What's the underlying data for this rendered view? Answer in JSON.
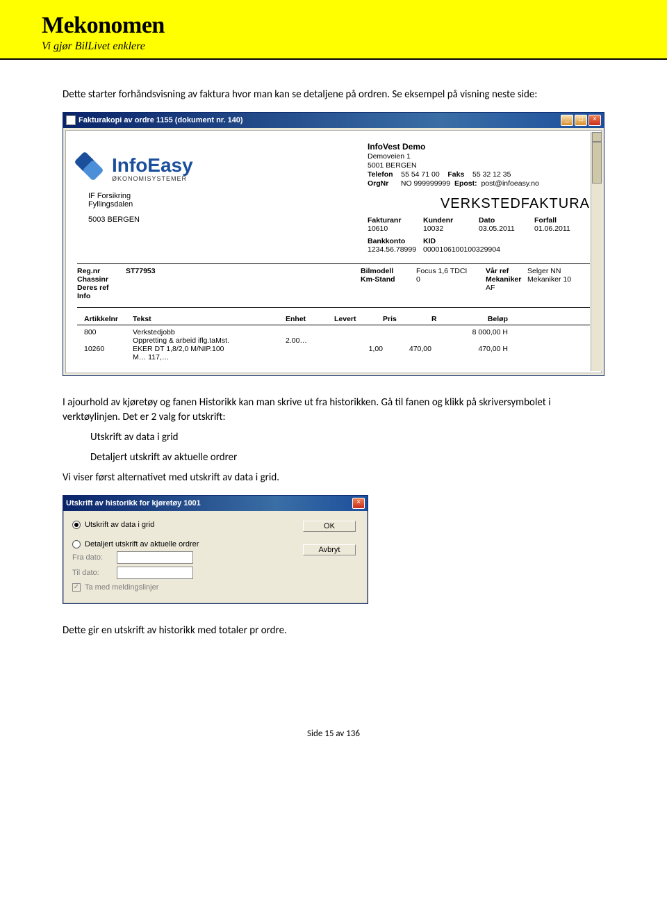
{
  "brand": {
    "name": "Mekonomen",
    "tagline": "Vi gjør BilLivet enklere"
  },
  "intro": {
    "p1": "Dette starter forhåndsvisning av faktura hvor man kan se detaljene på ordren. Se eksempel på visning neste side:"
  },
  "window1": {
    "title": "Fakturakopi av ordre 1155 (dokument nr. 140)",
    "logo_main": "InfoEasy",
    "logo_sub": "ØKONOMISYSTEMER",
    "company": {
      "name": "InfoVest Demo",
      "addr1": "Demoveien 1",
      "addr2": "5001 BERGEN",
      "tel_label": "Telefon",
      "tel": "55 54 71 00",
      "fax_label": "Faks",
      "fax": "55 32 12 35",
      "org_label": "OrgNr",
      "org": "NO 999999999",
      "email_label": "Epost:",
      "email": "post@infoeasy.no"
    },
    "doctype": "VERKSTEDFAKTURA",
    "customer": {
      "name": "IF Forsikring",
      "addr1": "Fyllingsdalen",
      "addr2": "5003 BERGEN"
    },
    "meta": {
      "heads": [
        "Fakturanr",
        "Kundenr",
        "Dato",
        "Forfall"
      ],
      "vals": [
        "10610",
        "10032",
        "03.05.2011",
        "01.06.2011"
      ],
      "bank_label": "Bankkonto",
      "bank": "1234.56.78999",
      "kid_label": "KID",
      "kid": "0000106100100329904"
    },
    "details": {
      "regnr_l": "Reg.nr",
      "regnr": "ST77953",
      "bilmodell_l": "Bilmodell",
      "bilmodell": "Focus 1,6 TDCI",
      "varref_l": "Vår ref",
      "varref": "Selger NN",
      "chassi_l": "Chassinr",
      "kmstand_l": "Km-Stand",
      "kmstand": "0",
      "mek_l": "Mekaniker",
      "mek": "Mekaniker 10",
      "deres_l": "Deres ref",
      "af": "AF",
      "info_l": "Info"
    },
    "lines_head": [
      "Artikkelnr",
      "Tekst",
      "Enhet",
      "Levert",
      "Pris",
      "R",
      "Beløp"
    ],
    "lines": [
      {
        "art": "800",
        "tekst": "Verkstedjobb",
        "enhet": "",
        "levert": "",
        "pris": "",
        "r": "",
        "belop": "8 000,00  H"
      },
      {
        "art": "",
        "tekst": "Oppretting & arbeid iflg.taMst.",
        "enhet": "2.00…",
        "levert": "",
        "pris": "",
        "r": "",
        "belop": ""
      },
      {
        "art": "10260",
        "tekst": "EKER DT 1,8/2,0 M/NIP.100",
        "enhet": "",
        "levert": "1,00",
        "pris": "470,00",
        "r": "",
        "belop": "470,00  H"
      },
      {
        "art": "",
        "tekst": "M…  117,…",
        "enhet": "",
        "levert": "",
        "pris": "",
        "r": "",
        "belop": ""
      }
    ]
  },
  "mid": {
    "p2a": "I ajourhold av kjøretøy og fanen Historikk kan man skrive ut fra historikken. Gå til fanen og klikk på skriversymbolet i verktøylinjen. Det er 2 valg for utskrift:",
    "opt1": "Utskrift av data i grid",
    "opt2": "Detaljert utskrift av aktuelle ordrer",
    "p3": "Vi viser først alternativet med utskrift av data i grid."
  },
  "dialog": {
    "title": "Utskrift av historikk for kjøretøy 1001",
    "radio1": "Utskrift av data i grid",
    "radio2": "Detaljert utskrift av aktuelle ordrer",
    "ok": "OK",
    "cancel": "Avbryt",
    "fra": "Fra dato:",
    "til": "Til dato:",
    "chk": "Ta med meldingslinjer"
  },
  "closing": {
    "p4": "Dette gir en utskrift av historikk med totaler pr ordre."
  },
  "pagenum": "Side 15 av 136"
}
